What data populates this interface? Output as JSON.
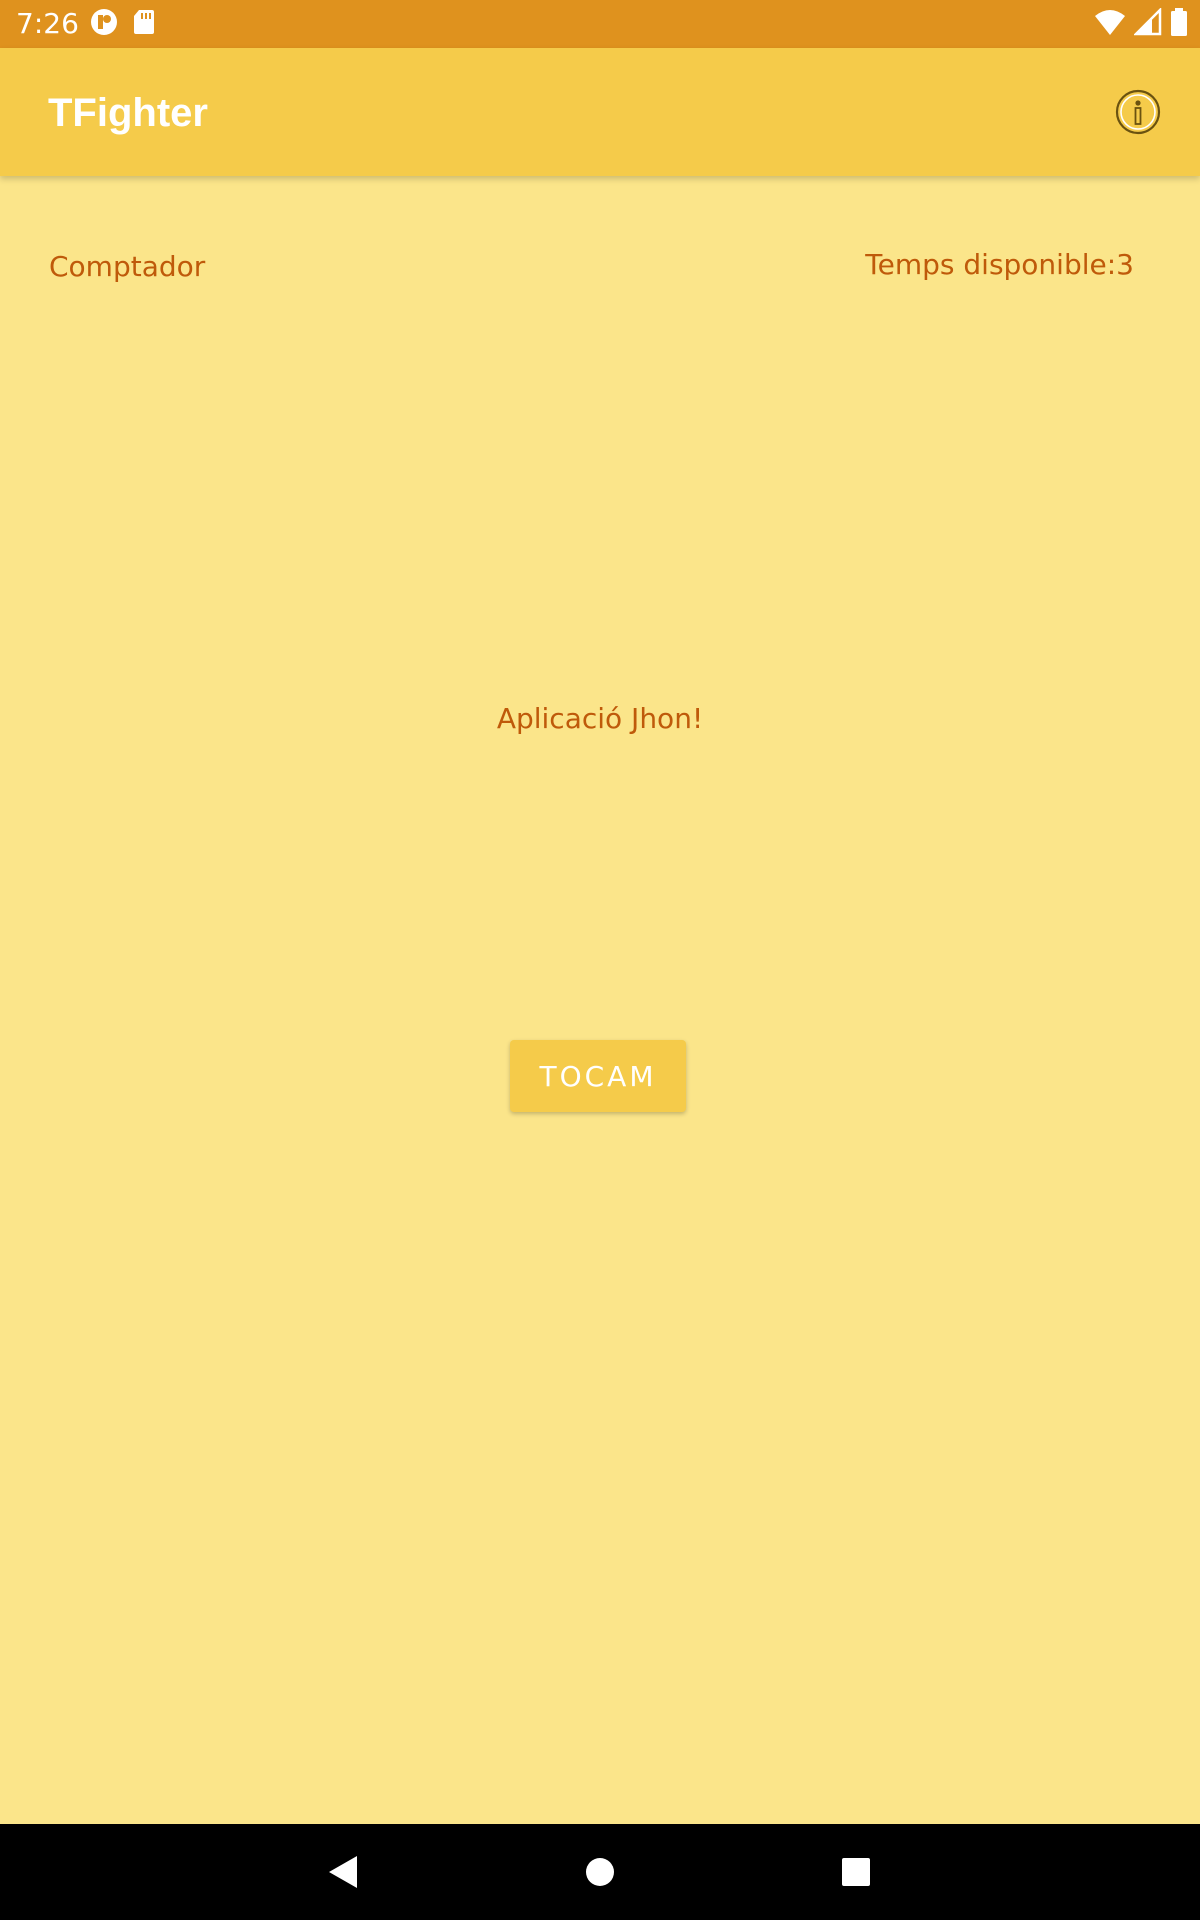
{
  "status_bar": {
    "time": "7:26",
    "icons": [
      "notification-app-icon",
      "sd-card-icon",
      "wifi-icon",
      "cell-signal-icon",
      "battery-icon"
    ]
  },
  "app_bar": {
    "title": "TFighter",
    "action_icon": "info-icon"
  },
  "content": {
    "counter_label": "Comptador",
    "time_label": "Temps disponible:3",
    "app_label": "Aplicació Jhon!",
    "button_label": "TOCAM"
  },
  "nav_bar": {
    "buttons": [
      "back-icon",
      "home-icon",
      "recents-icon"
    ]
  },
  "colors": {
    "status_bar": "#df921e",
    "app_bar": "#f5cb4a",
    "background": "#fbe58a",
    "text": "#bf5a0a",
    "button": "#f5cb4a"
  }
}
